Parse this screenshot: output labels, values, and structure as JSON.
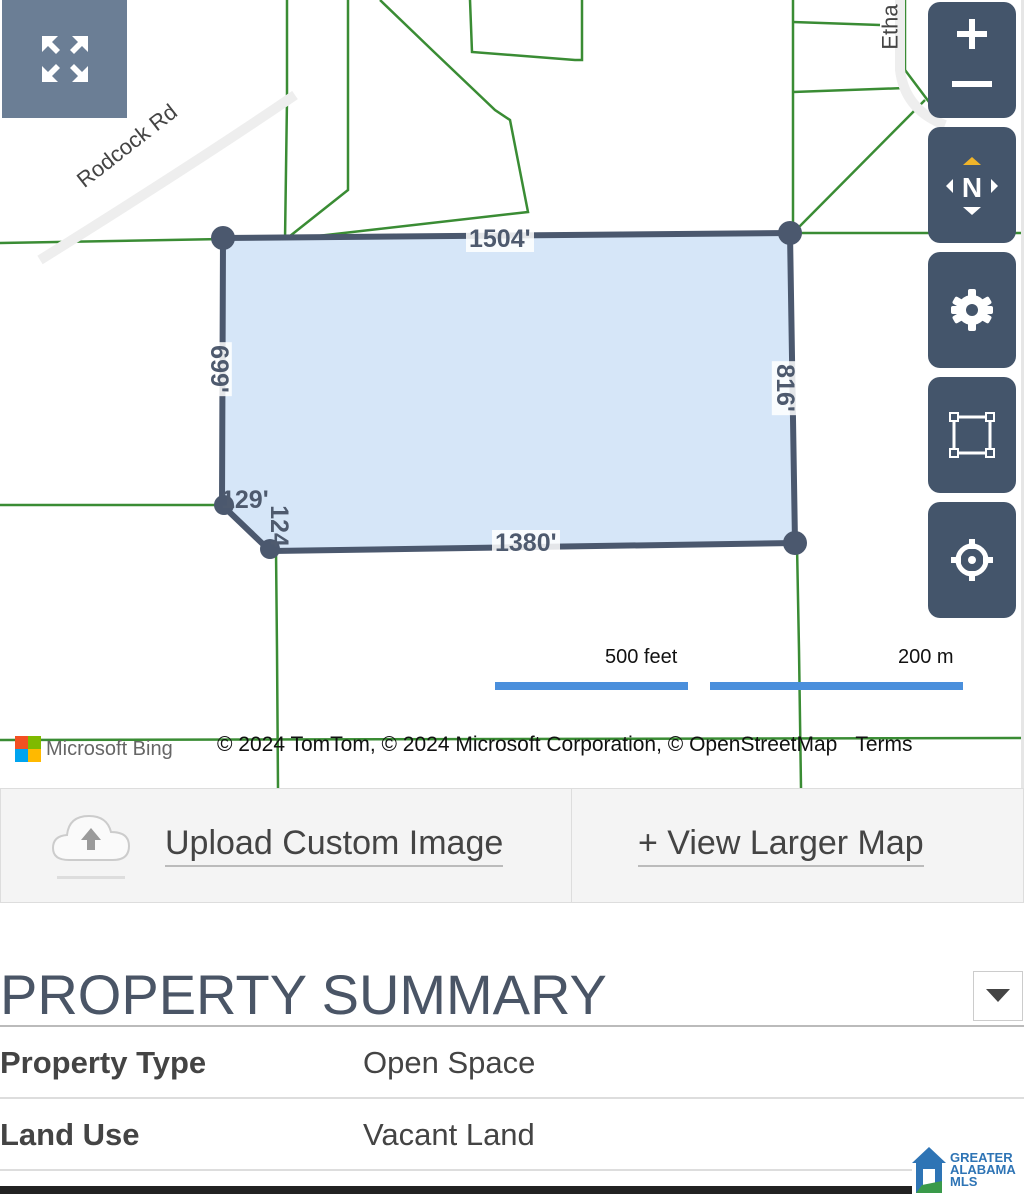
{
  "map": {
    "road_labels": {
      "rodcock": "Rodcock Rd",
      "etha": "Etha"
    },
    "parcel_dimensions": {
      "top": "1504'",
      "left": "699'",
      "right": "816'",
      "bottom": "1380'",
      "small_a": "129'",
      "small_b": "124'"
    },
    "controls": {
      "fullscreen": "fullscreen-icon",
      "zoom_in": "plus-icon",
      "zoom_out": "minus-icon",
      "compass_label": "N",
      "settings": "gear-icon",
      "select": "selection-box-icon",
      "locate": "crosshair-icon"
    },
    "scale": {
      "imperial": "500 feet",
      "metric": "200 m"
    },
    "bing_label": "Microsoft Bing",
    "attribution": "© 2024 TomTom, © 2024 Microsoft Corporation, © OpenStreetMap",
    "terms_label": "Terms",
    "colors": {
      "parcel_fill": "#d6e6f8",
      "parcel_stroke": "#4b586e",
      "parcel_lines": "#3a8c34",
      "control_bg": "#44556b",
      "scale_bar": "#4a8fdc",
      "compass_north": "#f0b429"
    }
  },
  "actions": {
    "upload_label": "Upload Custom Image",
    "view_larger_label": "+ View Larger Map"
  },
  "summary": {
    "title": "PROPERTY SUMMARY",
    "rows": [
      {
        "label": "Property Type",
        "value": "Open Space"
      },
      {
        "label": "Land Use",
        "value": "Vacant Land"
      }
    ]
  },
  "branding": {
    "mls_lines": [
      "GREATER",
      "ALABAMA",
      "MLS"
    ]
  }
}
